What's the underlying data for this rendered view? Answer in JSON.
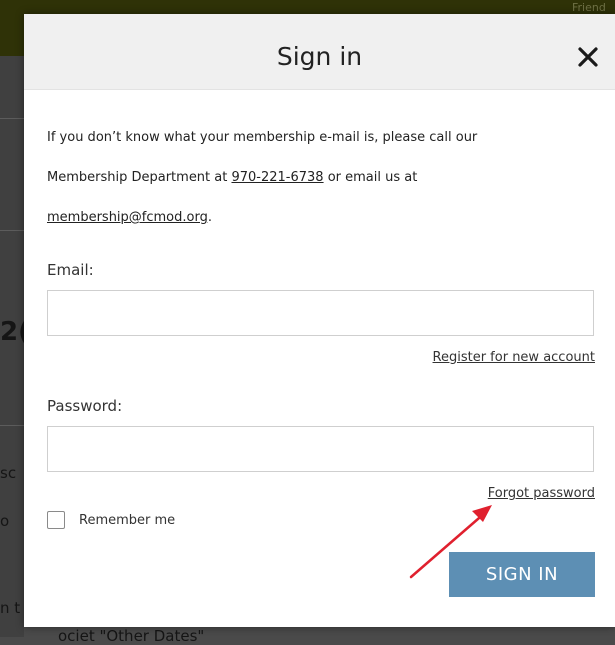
{
  "background": {
    "top_right_fragment": "Friend",
    "left_fragments": [
      "2(",
      "sc",
      "o",
      "n t"
    ],
    "bottom_fragment": "ociet \"Other Dates\""
  },
  "modal": {
    "title": "Sign in",
    "close_glyph": "✕",
    "info": {
      "line1": "If you don’t know what your membership e-mail is, please call our",
      "line2_prefix": "Membership Department at ",
      "phone": "970-221-6738",
      "line2_suffix": " or email us at",
      "email": "membership@fcmod.org",
      "line3_suffix": "."
    },
    "email_field": {
      "label": "Email:",
      "value": "",
      "placeholder": ""
    },
    "register_link": "Register for new account",
    "password_field": {
      "label": "Password:",
      "value": "",
      "placeholder": ""
    },
    "forgot_password_link": "Forgot password",
    "remember_me": {
      "label": "Remember me",
      "checked": false
    },
    "submit_button": "SIGN IN"
  },
  "colors": {
    "button": "#5d8fb4",
    "header": "#f0f0f0",
    "annotation_arrow": "#e0202e"
  },
  "icons": {
    "close": "close-icon",
    "annotation": "red-arrow-annotation"
  }
}
